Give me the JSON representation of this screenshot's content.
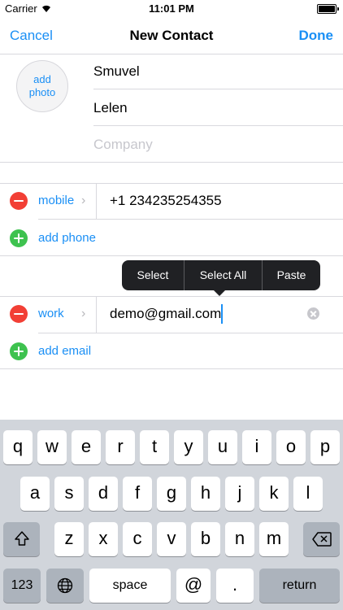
{
  "status_bar": {
    "carrier": "Carrier",
    "time": "11:01 PM"
  },
  "nav": {
    "cancel": "Cancel",
    "title": "New Contact",
    "done": "Done"
  },
  "photo": {
    "line1": "add",
    "line2": "photo"
  },
  "name": {
    "first": "Smuvel",
    "last": "Lelen",
    "company_placeholder": "Company"
  },
  "phone": {
    "label": "mobile",
    "value": "+1 234235254355",
    "add": "add phone"
  },
  "email": {
    "label": "work",
    "value": "demo@gmail.com",
    "add": "add email"
  },
  "edit_menu": {
    "select": "Select",
    "select_all": "Select All",
    "paste": "Paste"
  },
  "keyboard": {
    "row1": [
      "q",
      "w",
      "e",
      "r",
      "t",
      "y",
      "u",
      "i",
      "o",
      "p"
    ],
    "row2": [
      "a",
      "s",
      "d",
      "f",
      "g",
      "h",
      "j",
      "k",
      "l"
    ],
    "row3": [
      "z",
      "x",
      "c",
      "v",
      "b",
      "n",
      "m"
    ],
    "numbers": "123",
    "space": "space",
    "at": "@",
    "dot": ".",
    "return": "return"
  },
  "colors": {
    "accent": "#1a8ff5",
    "delete": "#f23f35",
    "add": "#3ec24f"
  }
}
